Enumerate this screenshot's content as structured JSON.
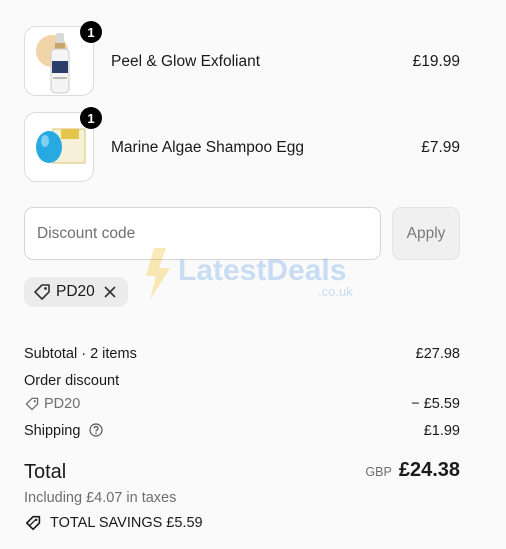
{
  "line_items": [
    {
      "name": "Peel & Glow Exfoliant",
      "price": "£19.99",
      "quantity": "1",
      "thumbnail": "serum-bottle-image"
    },
    {
      "name": "Marine Algae Shampoo Egg",
      "price": "£7.99",
      "quantity": "1",
      "thumbnail": "shampoo-egg-image"
    }
  ],
  "discount": {
    "placeholder": "Discount code",
    "apply_label": "Apply",
    "applied_code": "PD20"
  },
  "watermark": {
    "brand": "LatestDeals",
    "domain": ".co.uk"
  },
  "summary": {
    "subtotal_label": "Subtotal · 2 items",
    "subtotal_value": "£27.98",
    "order_discount_label": "Order discount",
    "order_discount_code": "PD20",
    "order_discount_value": "− £5.59",
    "shipping_label": "Shipping",
    "shipping_value": "£1.99",
    "total_label": "Total",
    "currency": "GBP",
    "total_value": "£24.38",
    "taxes_note": "Including £4.07 in taxes",
    "savings_label": "TOTAL SAVINGS £5.59"
  },
  "colors": {
    "text": "#1a1a1a",
    "muted": "#6e6e6e",
    "badge": "#000000",
    "background": "#fafafa"
  }
}
